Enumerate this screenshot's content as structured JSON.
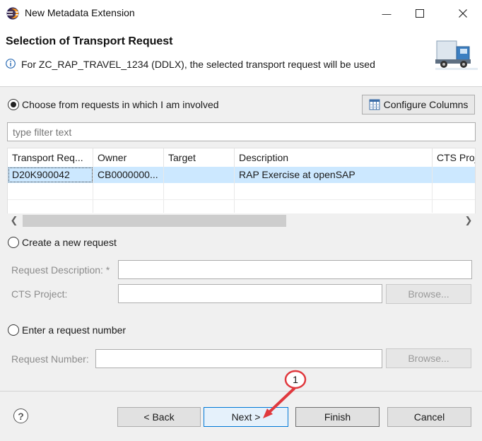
{
  "window": {
    "title": "New Metadata Extension",
    "minimize_glyph": "—",
    "maximize_glyph": "☐",
    "close_glyph": "✕"
  },
  "header": {
    "title": "Selection of Transport Request",
    "message": "For ZC_RAP_TRAVEL_1234 (DDLX), the selected transport request will be used",
    "info_icon": "info-icon",
    "banner_icon": "truck-icon"
  },
  "involved": {
    "label": "Choose from requests in which I am involved",
    "selected": true,
    "configure_columns_label": "Configure Columns",
    "filter_placeholder": "type filter text",
    "table": {
      "columns": [
        "Transport Req...",
        "Owner",
        "Target",
        "Description",
        "CTS Proj"
      ],
      "rows": [
        [
          "D20K900042",
          "CB0000000...",
          "",
          "RAP Exercise at openSAP",
          ""
        ]
      ]
    }
  },
  "new_request": {
    "label": "Create a new request",
    "selected": false,
    "description_label": "Request Description: *",
    "description_value": "",
    "cts_label": "CTS Project:",
    "cts_value": "",
    "browse_label": "Browse..."
  },
  "request_number": {
    "label": "Enter a request number",
    "selected": false,
    "number_label": "Request Number:",
    "number_value": "",
    "browse_label": "Browse..."
  },
  "footer": {
    "help_glyph": "?",
    "back_label": "< Back",
    "next_label": "Next >",
    "finish_label": "Finish",
    "cancel_label": "Cancel"
  },
  "annotation": {
    "step_number": "1",
    "color": "#e0393e"
  },
  "colors": {
    "selection": "#cce8ff",
    "primary_border": "#0078d7",
    "dialog_bg": "#f0f0f0"
  }
}
